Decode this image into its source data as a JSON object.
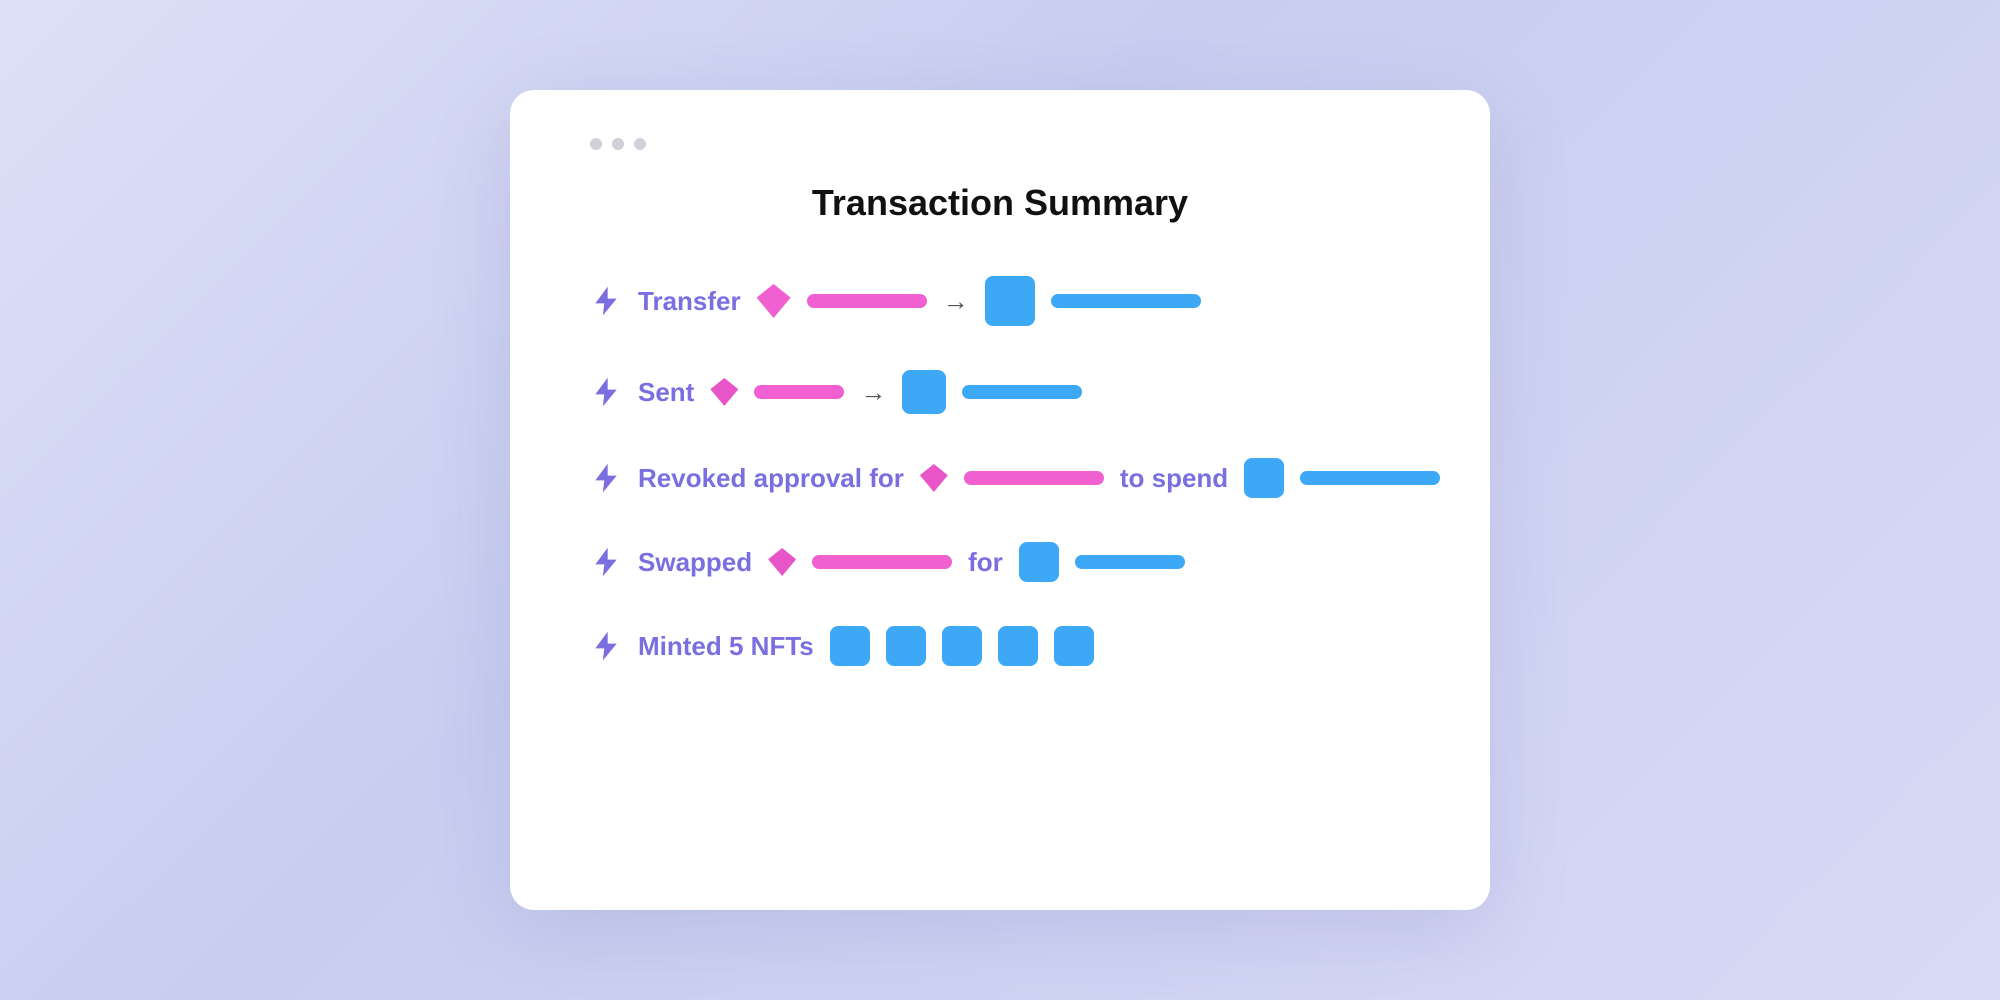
{
  "card": {
    "title": "Transaction Summary",
    "dots": [
      "dot1",
      "dot2",
      "dot3"
    ]
  },
  "transactions": [
    {
      "id": "transfer",
      "label": "Transfer",
      "type": "transfer",
      "arrow": "→"
    },
    {
      "id": "sent",
      "label": "Sent",
      "type": "sent",
      "arrow": "→"
    },
    {
      "id": "revoked",
      "label": "Revoked approval for",
      "type": "revoked",
      "connector": "to spend"
    },
    {
      "id": "swapped",
      "label": "Swapped",
      "type": "swapped",
      "connector": "for"
    },
    {
      "id": "minted",
      "label": "Minted 5 NFTs",
      "type": "minted"
    }
  ],
  "icons": {
    "lightning": "lightning-bolt-icon"
  }
}
